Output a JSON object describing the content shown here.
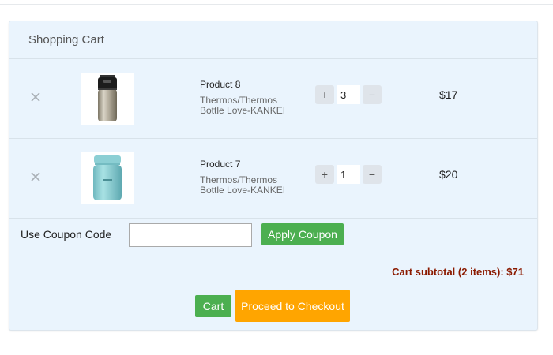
{
  "cart": {
    "title": "Shopping Cart",
    "items": [
      {
        "name": "Product 8",
        "description": "Thermos/Thermos Bottle Love-KANKEI",
        "quantity": "3",
        "price": "$17",
        "image_icon": "stainless-thermos-bottle-icon"
      },
      {
        "name": "Product 7",
        "description": "Thermos/Thermos Bottle Love-KANKEI",
        "quantity": "1",
        "price": "$20",
        "image_icon": "mint-thermos-jar-icon"
      }
    ],
    "qty_plus_label": "+",
    "qty_minus_label": "−",
    "remove_icon": "close-icon"
  },
  "coupon": {
    "label": "Use Coupon Code",
    "value": "",
    "placeholder": "",
    "apply_label": "Apply Coupon"
  },
  "summary": {
    "subtotal_text": "Cart subtotal (2 items): $71"
  },
  "actions": {
    "cart_label": "Cart",
    "checkout_label": "Proceed to Checkout"
  },
  "colors": {
    "panel_bg": "#eaf4fd",
    "green_button": "#4caf50",
    "orange_button": "#ffa500",
    "subtotal_text": "#8b1a00"
  }
}
